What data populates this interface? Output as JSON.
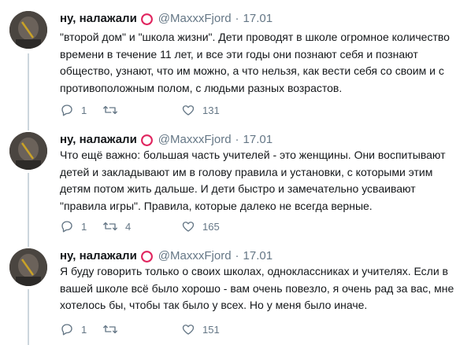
{
  "tweets": [
    {
      "name": "ну, налажали",
      "badge_icon": "red-circle-icon",
      "handle": "@MaxxxFjord",
      "separator": "·",
      "time": "17.01",
      "text": "\"второй дом\" и \"школа жизни\". Дети проводят в школе огромное количество\nвремени в течение 11 лет, и все эти годы они познают себя и познают\nобщество, узнают, что им можно, а что нельзя, как вести себя со своим и с\nпротивоположным полом, с людьми разных возрастов.",
      "reply_count": "1",
      "retweet_count": "",
      "like_count": "131"
    },
    {
      "name": "ну, налажали",
      "badge_icon": "red-circle-icon",
      "handle": "@MaxxxFjord",
      "separator": "·",
      "time": "17.01",
      "text": "Что ещё важно: большая часть учителей - это женщины. Они воспитывают\nдетей и закладывают им в голову правила и установки, с которыми этим\nдетям потом жить дальше. И дети быстро и замечательно усваивают\n\"правила игры\". Правила, которые далеко не всегда верные.",
      "reply_count": "1",
      "retweet_count": "4",
      "like_count": "165"
    },
    {
      "name": "ну, налажали",
      "badge_icon": "red-circle-icon",
      "handle": "@MaxxxFjord",
      "separator": "·",
      "time": "17.01",
      "text": "Я буду говорить только о своих школах, одноклассниках и учителях. Если в\nвашей школе всё было хорошо - вам очень повезло, я очень рад за вас, мне\nхотелось бы, чтобы так было у всех. Но у меня было иначе.",
      "reply_count": "1",
      "retweet_count": "",
      "like_count": "151"
    }
  ],
  "colors": {
    "text": "#14171a",
    "meta": "#657786",
    "badge": "#e0245e",
    "divider": "#e6ecf0",
    "thread": "#ccd6dd"
  },
  "icons": [
    "reply-icon",
    "retweet-icon",
    "like-icon",
    "red-circle-icon"
  ]
}
